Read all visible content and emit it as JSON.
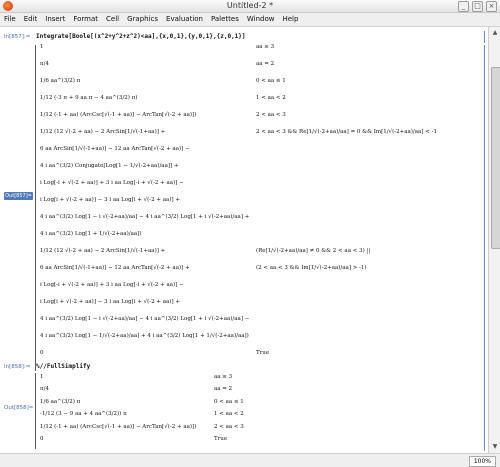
{
  "window": {
    "title": "Untitled-2 *",
    "min": "_",
    "max": "□",
    "close": "×"
  },
  "menu": [
    "File",
    "Edit",
    "Insert",
    "Format",
    "Cell",
    "Graphics",
    "Evaluation",
    "Palettes",
    "Window",
    "Help"
  ],
  "cells": {
    "in857_label": "In[857]:=",
    "in857_code": "Integrate[Boole[(x^2+y^2+z^2)<aa],{x,0,1},{y,0,1},{z,0,1}]",
    "out857_label": "Out[857]=",
    "in858_label": "In[858]:=",
    "in858_code": "%//FullSimplify",
    "out858_label": "Out[858]="
  },
  "out857_lines": [
    [
      "1",
      "aa ≥ 3"
    ],
    [
      "π/4",
      "aa = 2"
    ],
    [
      "1/6 aa^(3/2) π",
      "0 < aa ≤ 1"
    ],
    [
      "1/12 (-3 π + 9 aa π − 4 aa^(3/2) π)",
      "1 < aa < 2"
    ],
    [
      "1/12 (-1 + aa) (ArcCsc[√(-1 + aa)] − ArcTan[√(-2 + aa)])",
      "2 < aa < 3"
    ],
    [
      "1/12 (12 √(-2 + aa) − 2 ArcSin[1/√(-1+aa)] +",
      "2 < aa < 3 && Re[1/√(-2+aa)/aa] = 0 && Im[1/√(-2+aa)/aa] < -1"
    ],
    [
      "6 aa ArcSin[1/√(-1+aa)] − 12 aa ArcTan[√(-2 + aa)] −",
      ""
    ],
    [
      "4 i aa^(3/2) Conjugate[Log[1 − 1/√(-2+aa)/aa]] +",
      ""
    ],
    [
      "i Log[-i + √(-2 + aa)] + 3 i aa Log[-i + √(-2 + aa)] −",
      ""
    ],
    [
      "i Log[i + √(-2 + aa)] − 3 i aa Log[i + √(-2 + aa)] +",
      ""
    ],
    [
      "4 i aa^(3/2) Log[1 − i √(-2+aa)/aa] − 4 i aa^(3/2) Log[1 + i √(-2+aa)/aa] +",
      ""
    ],
    [
      "4 i aa^(3/2) Log[1 + 1/√(-2+aa)/aa])",
      ""
    ],
    [
      "1/12 (12 √(-2 + aa) − 2 ArcSin[1/√(-1+aa)] +",
      "(Re[1/√(-2+aa)/aa] ≠ 0 && 2 < aa < 3) ||"
    ],
    [
      "6 aa ArcSin[1/√(-1+aa)] − 12 aa ArcTan[√(-2 + aa)] +",
      "(2 < aa < 3 && Im[1/√(-2+aa)/aa] > -1)"
    ],
    [
      "i Log[-i + √(-2 + aa)] + 3 i aa Log[-i + √(-2 + aa)] −",
      ""
    ],
    [
      "i Log[i + √(-2 + aa)] − 3 i aa Log[i + √(-2 + aa)] +",
      ""
    ],
    [
      "4 i aa^(3/2) Log[1 − i √(-2+aa)/aa] − 4 i aa^(3/2) Log[1 + i √(-2+aa)/aa] −",
      ""
    ],
    [
      "4 i aa^(3/2) Log[1 − 1/√(-2+aa)/aa] + 4 i aa^(3/2) Log[1 + 1/√(-2+aa)/aa])",
      ""
    ],
    [
      "0",
      "True"
    ]
  ],
  "out858_lines": [
    [
      "1",
      "aa ≥ 3"
    ],
    [
      "π/4",
      "aa = 2"
    ],
    [
      "1/6 aa^(3/2) π",
      "0 < aa ≤ 1"
    ],
    [
      "-1/12 (3 − 9 aa + 4 aa^(3/2)) π",
      "1 < aa < 2"
    ],
    [
      "1/12 (-1 + aa) (ArcCsc[√(-1 + aa)] − ArcTan[√(-2 + aa)])",
      "2 < aa < 3"
    ],
    [
      "0",
      "True"
    ]
  ],
  "status": {
    "zoom": "100%"
  }
}
